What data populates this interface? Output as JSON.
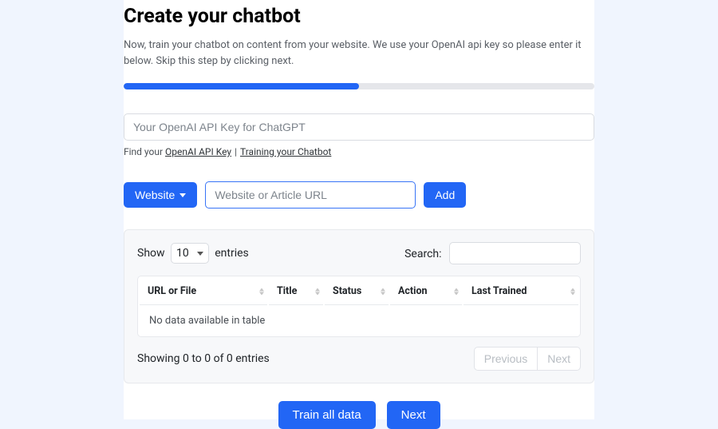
{
  "page": {
    "title": "Create your chatbot",
    "subtitle": "Now, train your chatbot on content from your website. We use your OpenAI api key so please enter it below. Skip this step by clicking next.",
    "progress_percent": 50
  },
  "api": {
    "placeholder": "Your OpenAI API Key for ChatGPT",
    "helper_prefix": "Find your ",
    "link1": "OpenAI API Key",
    "link2": "Training your Chatbot"
  },
  "source": {
    "dropdown_label": "Website",
    "url_placeholder": "Website or Article URL",
    "add_label": "Add"
  },
  "table": {
    "show_label": "Show",
    "entries_label": "entries",
    "entries_value": "10",
    "search_label": "Search:",
    "search_value": "",
    "columns": [
      "URL or File",
      "Title",
      "Status",
      "Action",
      "Last Trained"
    ],
    "empty_message": "No data available in table",
    "info_text": "Showing 0 to 0 of 0 entries",
    "prev_label": "Previous",
    "next_label": "Next"
  },
  "footer": {
    "train_label": "Train all data",
    "next_label": "Next"
  },
  "colors": {
    "primary": "#2266f5",
    "page_bg": "#f0f5fe",
    "card_bg": "#ffffff",
    "section_bg": "#f7f8fa",
    "border": "#e7e9ed",
    "text_muted": "#6c757d"
  }
}
